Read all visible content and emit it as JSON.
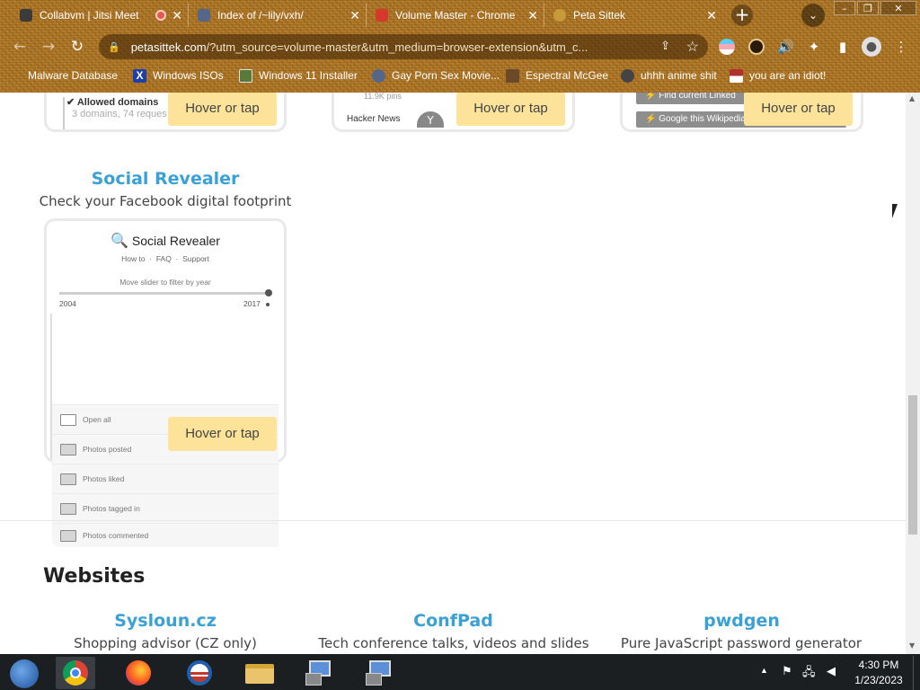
{
  "browser": {
    "tabs": [
      {
        "title": "Collabvm | Jitsi Meet",
        "favicon_color": "#3b3b3b"
      },
      {
        "title": "Index of /~lily/vxh/",
        "favicon_color": "#556688"
      },
      {
        "title": "Volume Master - Chrome",
        "favicon_color": "#d33a2c"
      },
      {
        "title": "Peta Sittek",
        "favicon_color": "#c79a3a"
      }
    ],
    "new_tab_label": "+",
    "url_host": "petasittek.com",
    "url_rest": "/?utm_source=volume-master&utm_medium=browser-extension&utm_c...",
    "bookmarks": [
      {
        "label": "Malware Database",
        "icon_color": "#8b6a2a"
      },
      {
        "label": "Windows ISOs",
        "icon_color": "#1c3fa8"
      },
      {
        "label": "Windows 11 Installer",
        "icon_color": "#5a7a3a"
      },
      {
        "label": "Gay Porn Sex Movie...",
        "icon_color": "#556688"
      },
      {
        "label": "Espectral McGee",
        "icon_color": "#6b4a2a"
      },
      {
        "label": "uhhh anime shit",
        "icon_color": "#444444"
      },
      {
        "label": "you are an idiot!",
        "icon_color": "#b03030"
      }
    ]
  },
  "page": {
    "hover_label": "Hover or tap",
    "top_cards": [
      {
        "line1": "✔ Allowed domains",
        "line2": "3 domains, 74 reques"
      },
      {
        "line1": "11.9K pins",
        "line2": "Hacker News"
      },
      {
        "line1": "⚡ Find current Linked",
        "line2": "⚡ Google this Wikipedia article"
      }
    ],
    "social_revealer": {
      "title": "Social Revealer",
      "subtitle": "Check your Facebook digital footprint",
      "preview": {
        "app_name": "Social Revealer",
        "nav": "How to  ·  FAQ  ·  Support",
        "slider_caption": "Move slider to filter by year",
        "year_start": "2004",
        "year_end": "2017",
        "rows": [
          "Open all",
          "Photos posted",
          "Photos liked",
          "Photos tagged in",
          "Photos commented"
        ]
      }
    },
    "websites_heading": "Websites",
    "websites": [
      {
        "title": "Sysloun.cz",
        "subtitle": "Shopping advisor (CZ only)"
      },
      {
        "title": "ConfPad",
        "subtitle": "Tech conference talks, videos and slides"
      },
      {
        "title": "pwdgen",
        "subtitle": "Pure JavaScript password generator"
      }
    ]
  },
  "taskbar": {
    "time": "4:30 PM",
    "date": "1/23/2023"
  },
  "colors": {
    "accent_title": "#3aa0d6",
    "hover_bg": "#fde39a",
    "taskbar_bg": "#1c1f22"
  }
}
